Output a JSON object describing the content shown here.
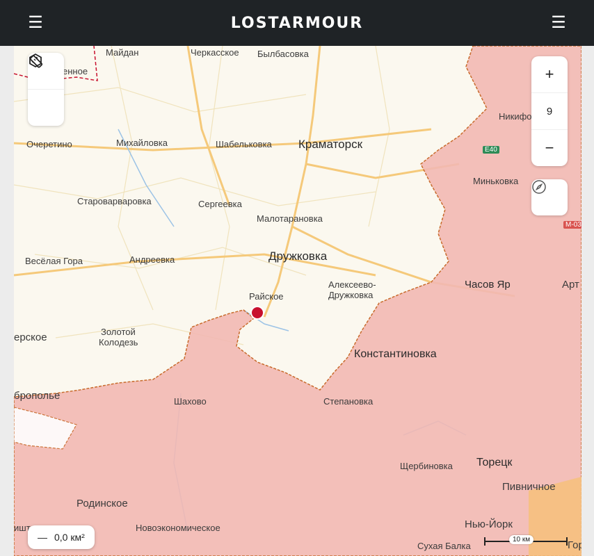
{
  "header": {
    "title": "LOSTARMOUR",
    "left_menu_icon": "hamburger-menu-icon",
    "right_menu_icon": "hamburger-menu-icon"
  },
  "map_controls": {
    "tools": [
      {
        "icon": "ruler-icon"
      },
      {
        "icon": "hexagon-polygon-icon"
      }
    ],
    "zoom_in": "+",
    "zoom_level": "9",
    "zoom_out": "−",
    "compass_icon": "compass-icon",
    "area_toggle": "—",
    "area_value": "0,0 км²",
    "scale_label": "10 км"
  },
  "colors": {
    "occupied_area": "#f2b8b2",
    "occupied_border": "#c86b2c",
    "marker": "#c8102e",
    "header_bg": "#1f2326"
  },
  "places": [
    {
      "name": "Майдан"
    },
    {
      "name": "Черкасское"
    },
    {
      "name": "Былбасовка"
    },
    {
      "name": "енное"
    },
    {
      "name": "Никифо"
    },
    {
      "name": "Очеретино"
    },
    {
      "name": "Михайловка"
    },
    {
      "name": "Шабельковка"
    },
    {
      "name": "Краматорск"
    },
    {
      "name": "E40"
    },
    {
      "name": "Миньковка"
    },
    {
      "name": "Староварваровка"
    },
    {
      "name": "Сергеевка"
    },
    {
      "name": "Малотарановка"
    },
    {
      "name": "М-03"
    },
    {
      "name": "Весёлая Гора"
    },
    {
      "name": "Андреевка"
    },
    {
      "name": "Дружковка"
    },
    {
      "name": "Алексеево-"
    },
    {
      "name": "Дружковка"
    },
    {
      "name": "Часов Яр"
    },
    {
      "name": "Арт"
    },
    {
      "name": "Райское"
    },
    {
      "name": "ерское"
    },
    {
      "name": "Золотой"
    },
    {
      "name": "Колодезь"
    },
    {
      "name": "Константиновка"
    },
    {
      "name": "брополье"
    },
    {
      "name": "Шахово"
    },
    {
      "name": "Степановка"
    },
    {
      "name": "Щербиновка"
    },
    {
      "name": "Торецк"
    },
    {
      "name": "Пивничное"
    },
    {
      "name": "Родинское"
    },
    {
      "name": "Новоэкономическое"
    },
    {
      "name": "Нью-Йорк"
    },
    {
      "name": "Сухая Балка"
    },
    {
      "name": "ишт"
    },
    {
      "name": "Гор"
    }
  ]
}
